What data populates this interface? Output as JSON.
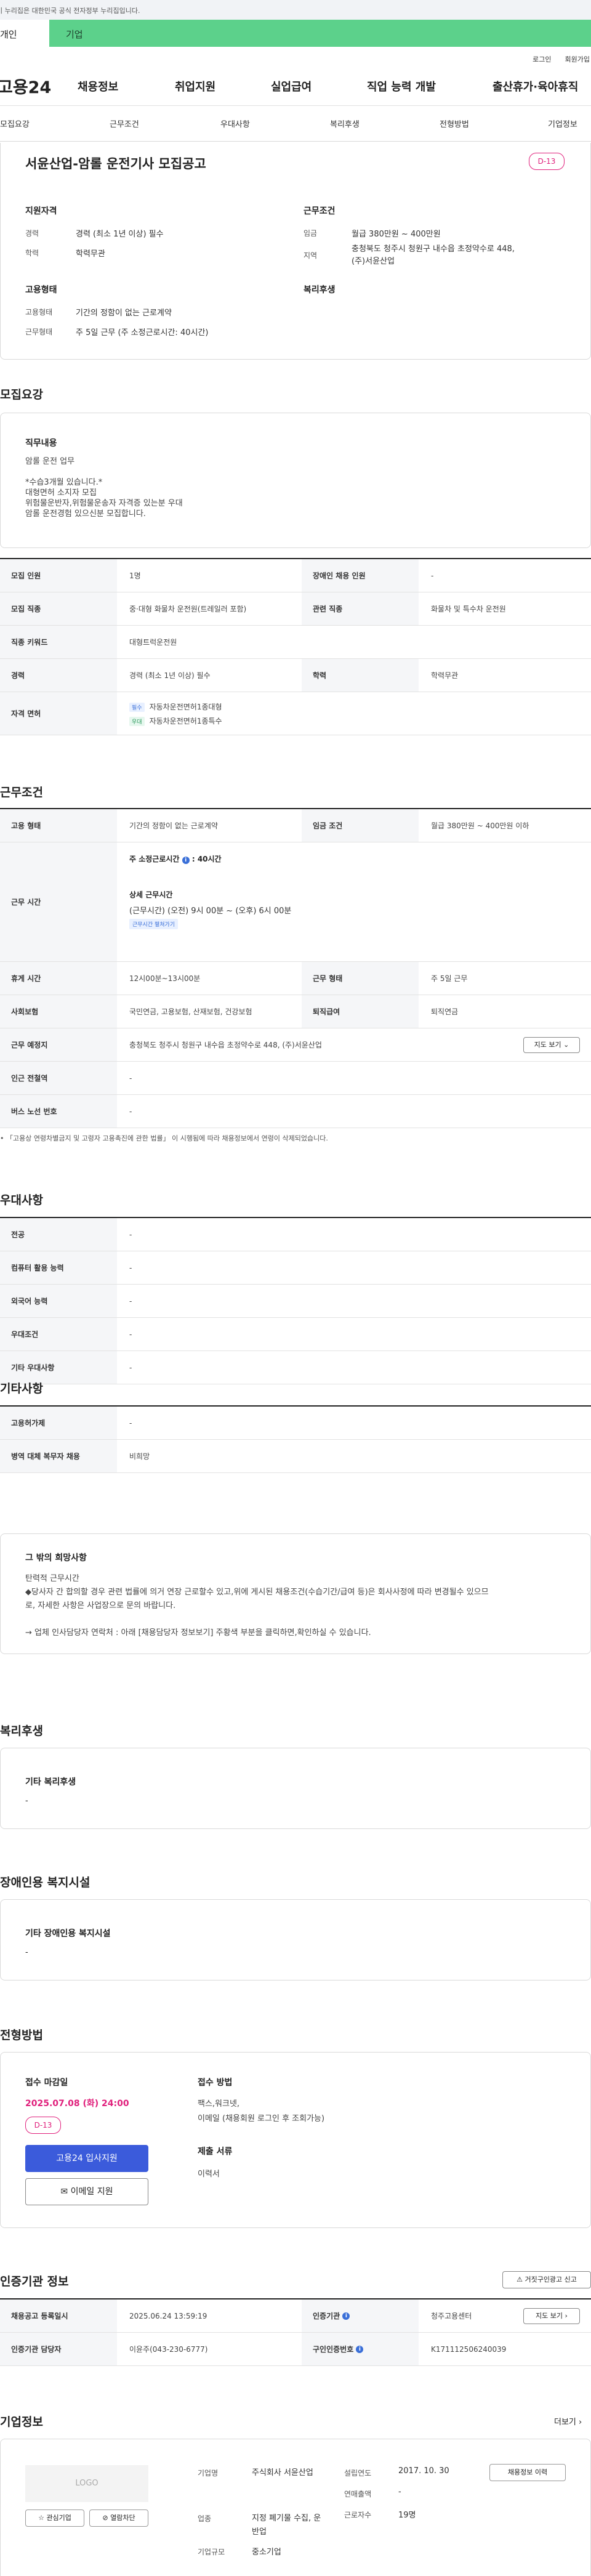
{
  "gov_banner": "이 누리집은 대한민국 공식 전자정부 누리집입니다.",
  "top_tabs": {
    "person": "개인",
    "company": "기업"
  },
  "util": {
    "login": "로그인",
    "join": "회원가입"
  },
  "site": {
    "logo": "고용24"
  },
  "gnb": [
    "채용정보",
    "취업지원",
    "실업급여",
    "직업 능력 개발",
    "출산휴가·육아휴직"
  ],
  "snb": [
    "모집요강",
    "근무조건",
    "우대사항",
    "복리후생",
    "전형방법",
    "기업정보"
  ],
  "summary": {
    "title": "서윤산업-암롤 운전기사 모집공고",
    "dday": "D-13",
    "qual_heading": "지원자격",
    "career_lbl": "경력",
    "career": "경력 (최소 1년 이상) 필수",
    "edu_lbl": "학력",
    "edu": "학력무관",
    "cond_heading": "근무조건",
    "wage_lbl": "임금",
    "wage": "월급 380만원 ~ 400만원",
    "region_lbl": "지역",
    "region": "충청북도 청주시 청원구 내수읍 초정약수로 448, (주)서윤산업",
    "emp_heading": "고용형태",
    "emp_type_lbl": "고용형태",
    "emp_type": "기간의 정함이 없는 근로계약",
    "work_form_lbl": "근무형태",
    "work_form": "주 5일 근무 (주 소정근로시간: 40시간)",
    "welfare_heading": "복리후생"
  },
  "recruit": {
    "heading": "모집요강",
    "job_desc_title": "직무내용",
    "job_desc_lines": [
      "암롤 운전 업무",
      "",
      "*수습3개월 있습니다.*",
      "대형면허 소지자 모집",
      "위험물운반자,위험물운송자 자격증 있는분 우대",
      "암롤 운전경험 있으신분 모집합니다."
    ],
    "rows": {
      "count_lbl": "모집 인원",
      "count": "1명",
      "disabled_lbl": "장애인 채용 인원",
      "disabled": "-",
      "job_lbl": "모집 직종",
      "job": "중·대형 화물차 운전원(트레일러 포함)",
      "related_lbl": "관련 직종",
      "related": "화물차 및 특수차 운전원",
      "keyword_lbl": "직종 키워드",
      "keyword": "대형트럭운전원",
      "career_lbl": "경력",
      "career": "경력 (최소 1년 이상) 필수",
      "edu_lbl": "학력",
      "edu": "학력무관",
      "license_lbl": "자격 면허",
      "license1_tag": "필수",
      "license1": "자동차운전면허1종대형",
      "license2_tag": "우대",
      "license2": "자동차운전면허1종특수"
    }
  },
  "conditions": {
    "heading": "근무조건",
    "emp_lbl": "고용 형태",
    "emp": "기간의 정함이 없는 근로계약",
    "wage_lbl": "임금 조건",
    "wage": "월급 380만원 ~ 400만원 이하",
    "hours_lbl": "근무 시간",
    "weekly": "주 소정근로시간",
    "weekly_val": ": 40시간",
    "detail_title": "상세 근무시간",
    "detail": "(근무시간) (오전) 9시 00분 ~ (오후) 6시 00분",
    "detail_btn": "근무시간 펼쳐가기",
    "break_lbl": "휴게 시간",
    "break": "12시00분~13시00분",
    "form_lbl": "근무 형태",
    "form": "주 5일 근무",
    "insurance_lbl": "사회보험",
    "insurance": "국민연금, 고용보험, 산재보험, 건강보험",
    "severance_lbl": "퇴직급여",
    "severance": "퇴직연금",
    "place_lbl": "근무 예정지",
    "place": "충청북도 청주시 청원구 내수읍 초정약수로 448, (주)서윤산업",
    "map_btn": "지도 보기",
    "subway_lbl": "인근 전철역",
    "subway": "-",
    "bus_lbl": "버스 노선 번호",
    "bus": "-",
    "note": "「고용상 연령차별금지 및 고령자 고용촉진에 관한 법률」 이 시행됨에 따라 채용정보에서 연령이 삭제되었습니다."
  },
  "prefs": {
    "heading": "우대사항",
    "major_lbl": "전공",
    "major": "-",
    "pc_lbl": "컴퓨터 활용 능력",
    "pc": "-",
    "lang_lbl": "외국어 능력",
    "lang": "-",
    "cond_lbl": "우대조건",
    "cond": "-",
    "etc_lbl": "기타 우대사항",
    "etc": "-"
  },
  "misc": {
    "heading": "기타사항",
    "permit_lbl": "고용허가제",
    "permit": "-",
    "military_lbl": "병역 대체 복무자 채용",
    "military": "비희망",
    "wish_title": "그 밖의 희망사항",
    "wish_lines": [
      "탄력적 근무시간",
      "◆당사자 간 합의할 경우 관련 법률에 의거 연장 근로할수 있고,위에 게시된 채용조건(수습기간/급여 등)은 회사사정에 따라 변경될수 있으므",
      "로, 자세한 사항은 사업장으로 문의 바랍니다.",
      "",
      "→ 업체 인사담당자 연락처 : 아래 [채용담당자 정보보기] 주황색 부분을 클릭하면,확인하실 수 있습니다."
    ]
  },
  "welfare": {
    "heading": "복리후생",
    "title": "기타 복리후생",
    "value": "-"
  },
  "facilities": {
    "heading": "장애인용 복지시설",
    "title": "기타 장애인용 복지시설",
    "value": "-"
  },
  "selection": {
    "heading": "전형방법",
    "deadline_lbl": "접수 마감일",
    "deadline": "2025.07.08 (화) 24:00",
    "dday": "D-13",
    "apply_btn": "고용24 입사지원",
    "email_btn": "이메일 지원",
    "method_lbl": "접수 방법",
    "method": "팩스,워크넷,",
    "method2": "이메일 (채용회원 로그인 후 조회가능)",
    "docs_lbl": "제출 서류",
    "docs": "이력서"
  },
  "cert": {
    "heading": "인증기관 정보",
    "report_btn": "거짓구인광고 신고",
    "reg_lbl": "채용공고 등록일시",
    "reg": "2025.06.24 13:59:19",
    "agency_lbl": "인증기관",
    "agency": "청주고용센터",
    "map_btn": "지도 보기",
    "manager_lbl": "인증기관 담당자",
    "manager": "이윤주(043-230-6777)",
    "id_lbl": "구인인증번호",
    "id": "K171112506240039"
  },
  "company": {
    "heading": "기업정보",
    "more": "더보기",
    "logo": "LOGO",
    "fav_btn": "관심기업",
    "block_btn": "열람차단",
    "name_lbl": "기업명",
    "name": "주식회사 서윤산업",
    "industry_lbl": "업종",
    "industry": "지정 폐기물 수집, 운반업",
    "size_lbl": "기업규모",
    "size": "중소기업",
    "est_lbl": "설립연도",
    "est": "2017. 10. 30",
    "sales_lbl": "연매출액",
    "sales": "-",
    "emp_lbl": "근로자수",
    "emp": "19명",
    "hire_btn": "채용정보 이력"
  }
}
